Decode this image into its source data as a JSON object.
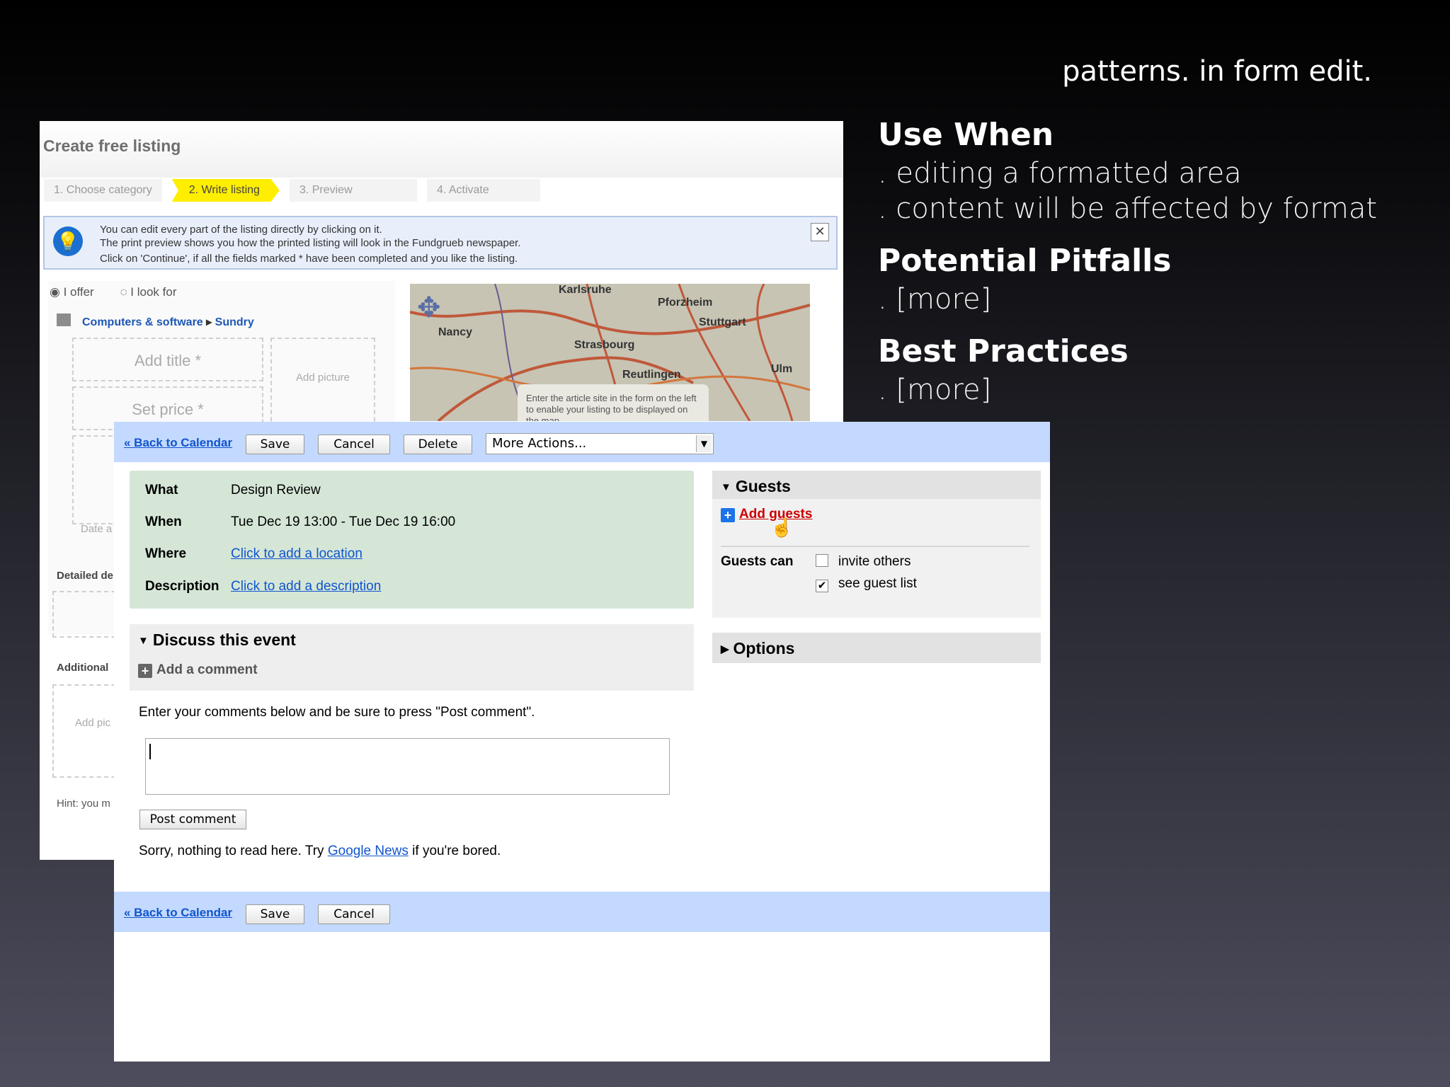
{
  "slide": {
    "title": "patterns. in form edit.",
    "sections": [
      {
        "heading": "Use When",
        "items": [
          ". editing a formatted area",
          ". content will be affected by format"
        ]
      },
      {
        "heading": "Potential Pitfalls",
        "items": [
          ". [more]"
        ]
      },
      {
        "heading": "Best Practices",
        "items": [
          ". [more]"
        ]
      }
    ]
  },
  "listing": {
    "title": "Create free listing",
    "steps": [
      "1. Choose category",
      "2. Write listing",
      "3. Preview",
      "4. Activate"
    ],
    "info_lines": [
      "You can edit every part of the listing directly by clicking on it.",
      "The print preview shows you how the printed listing will look in the Fundgrueb newspaper.",
      "Click on 'Continue', if all the fields marked * have been completed and you like the listing."
    ],
    "radio_offer": "I offer",
    "radio_look": "I look for",
    "category": "Computers & software",
    "category_sep": "▸",
    "subcategory": "Sundry",
    "add_title": "Add title *",
    "set_price": "Set price *",
    "add_picture": "Add picture",
    "date_label": "Date a",
    "detailed_label": "Detailed de",
    "additional_label": "Additional",
    "add_pic_small": "Add pic",
    "hint": "Hint: you m",
    "map_cities": [
      "Karlsruhe",
      "Pforzheim",
      "Stuttgart",
      "Nancy",
      "Strasbourg",
      "Reutlingen",
      "Ulm"
    ],
    "map_tooltip": "Enter the article site in the form on the left to enable your listing to be displayed on the map."
  },
  "event": {
    "back_link": "« Back to Calendar",
    "save": "Save",
    "cancel": "Cancel",
    "delete": "Delete",
    "more_actions": "More Actions...",
    "what_label": "What",
    "what_value": "Design Review",
    "when_label": "When",
    "when_value": "Tue Dec 19 13:00 - Tue Dec 19 16:00",
    "where_label": "Where",
    "where_value": "Click to add a location",
    "desc_label": "Description",
    "desc_value": "Click to add a description",
    "discuss_title": "Discuss this event",
    "add_comment": "Add a comment",
    "comment_help": "Enter your comments below and be sure to press \"Post comment\".",
    "comment_value": "",
    "post_comment": "Post comment",
    "sorry_prefix": "Sorry, nothing to read here. Try ",
    "sorry_link": "Google News",
    "sorry_suffix": " if you're bored.",
    "guests_title": "Guests",
    "add_guests": "Add guests",
    "guests_can": "Guests can",
    "invite_others": "invite others",
    "invite_checked": false,
    "see_guest_list": "see guest list",
    "see_checked": true,
    "options_title": "Options"
  }
}
